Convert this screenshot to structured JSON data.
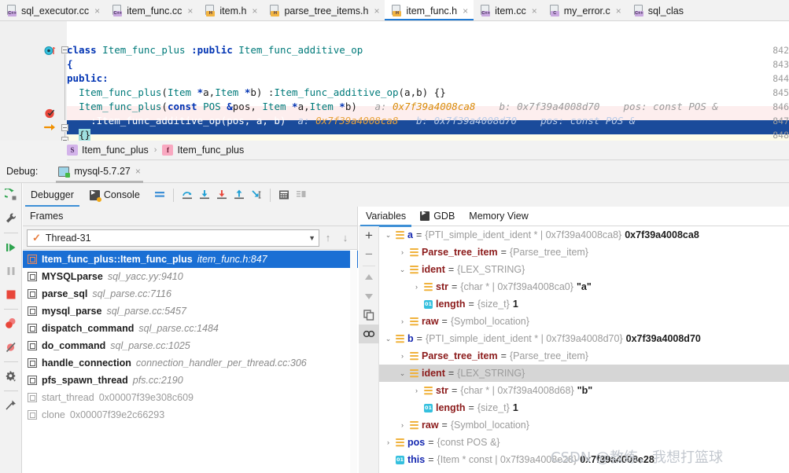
{
  "editor_tabs": [
    {
      "label": "sql_executor.cc",
      "kind": "cpp",
      "badge": "C++",
      "active": false,
      "close": "×"
    },
    {
      "label": "item_func.cc",
      "kind": "cpp",
      "badge": "C++",
      "active": false,
      "close": "×"
    },
    {
      "label": "item.h",
      "kind": "h",
      "badge": "H",
      "active": false,
      "close": "×"
    },
    {
      "label": "parse_tree_items.h",
      "kind": "h",
      "badge": "H",
      "active": false,
      "close": "×"
    },
    {
      "label": "item_func.h",
      "kind": "h",
      "badge": "H",
      "active": true,
      "close": "×"
    },
    {
      "label": "item.cc",
      "kind": "cpp",
      "badge": "C++",
      "active": false,
      "close": "×"
    },
    {
      "label": "my_error.c",
      "kind": "c",
      "badge": "C",
      "active": false,
      "close": "×"
    },
    {
      "label": "sql_clas",
      "kind": "cpp",
      "badge": "C++",
      "active": false,
      "close": ""
    }
  ],
  "code": {
    "line_numbers": [
      "842",
      "843",
      "844",
      "845",
      "846",
      "847",
      "848"
    ],
    "lines": [
      {
        "n": "842",
        "text": "class Item_func_plus :public Item_func_additive_op",
        "bg": "none"
      },
      {
        "n": "843",
        "text": "{",
        "bg": "none"
      },
      {
        "n": "844",
        "text": "public:",
        "bg": "none"
      },
      {
        "n": "845",
        "text": "  Item_func_plus(Item *a,Item *b) :Item_func_additive_op(a,b) {}",
        "bg": "none"
      },
      {
        "n": "846",
        "text": "  Item_func_plus(const POS &pos, Item *a,Item *b)",
        "bg": "exec"
      },
      {
        "n": "847",
        "text": "    :Item_func_additive_op(pos, a, b)",
        "bg": "cur"
      },
      {
        "n": "848",
        "text": "  {}",
        "bg": "last"
      }
    ],
    "inline_hints": {
      "line846": [
        {
          "label": "a:",
          "value": "0x7f39a4008ca8"
        },
        {
          "label": "b:",
          "value": "0x7f39a4008d70"
        },
        {
          "label": "pos:",
          "value": "const POS &"
        }
      ],
      "line847": [
        {
          "label": "a:",
          "value": "0x7f39a4008ca8"
        },
        {
          "label": "b:",
          "value": "0x7f39a4008d70"
        },
        {
          "label": "pos:",
          "value": "const POS &"
        }
      ]
    }
  },
  "breadcrumb": [
    {
      "chip": "S",
      "label": "Item_func_plus"
    },
    {
      "chip": "f",
      "label": "Item_func_plus"
    }
  ],
  "breadcrumb_separator": "›",
  "debug_header": {
    "label": "Debug:",
    "run_config": "mysql-5.7.27",
    "close": "×"
  },
  "debugger_tabs": [
    {
      "label": "Debugger",
      "active": true
    },
    {
      "label": "Console",
      "active": false
    }
  ],
  "frames": {
    "header": "Frames",
    "thread": "Thread-31",
    "items": [
      {
        "fn": "Item_func_plus::Item_func_plus",
        "loc": "item_func.h:847",
        "selected": true,
        "dim": false
      },
      {
        "fn": "MYSQLparse",
        "loc": "sql_yacc.yy:9410",
        "selected": false,
        "dim": false
      },
      {
        "fn": "parse_sql",
        "loc": "sql_parse.cc:7116",
        "selected": false,
        "dim": false
      },
      {
        "fn": "mysql_parse",
        "loc": "sql_parse.cc:5457",
        "selected": false,
        "dim": false
      },
      {
        "fn": "dispatch_command",
        "loc": "sql_parse.cc:1484",
        "selected": false,
        "dim": false
      },
      {
        "fn": "do_command",
        "loc": "sql_parse.cc:1025",
        "selected": false,
        "dim": false
      },
      {
        "fn": "handle_connection",
        "loc": "connection_handler_per_thread.cc:306",
        "selected": false,
        "dim": false
      },
      {
        "fn": "pfs_spawn_thread",
        "loc": "pfs.cc:2190",
        "selected": false,
        "dim": false
      },
      {
        "fn": "start_thread",
        "loc": "0x00007f39e308c609",
        "selected": false,
        "dim": true
      },
      {
        "fn": "clone",
        "loc": "0x00007f39e2c66293",
        "selected": false,
        "dim": true
      }
    ]
  },
  "variables": {
    "tabs": [
      {
        "label": "Variables",
        "active": true
      },
      {
        "label": "GDB",
        "active": false
      },
      {
        "label": "Memory View",
        "active": false
      }
    ],
    "rows": [
      {
        "indent": 0,
        "twisty": "⌄",
        "icon": "struct",
        "icon_label": "",
        "name": "a",
        "name_color": "blue",
        "type": "{PTI_simple_ident_ident * | 0x7f39a4008ca8}",
        "value": "0x7f39a4008ca8",
        "selected": false
      },
      {
        "indent": 1,
        "twisty": "›",
        "icon": "struct",
        "icon_label": "",
        "name": "Parse_tree_item",
        "name_color": "red",
        "type": "{Parse_tree_item}",
        "value": "",
        "selected": false
      },
      {
        "indent": 1,
        "twisty": "⌄",
        "icon": "struct",
        "icon_label": "",
        "name": "ident",
        "name_color": "red",
        "type": "{LEX_STRING}",
        "value": "",
        "selected": false
      },
      {
        "indent": 2,
        "twisty": "›",
        "icon": "struct",
        "icon_label": "",
        "name": "str",
        "name_color": "red",
        "type": "{char * | 0x7f39a4008ca0}",
        "value": "\"a\"",
        "selected": false
      },
      {
        "indent": 2,
        "twisty": "",
        "icon": "prim",
        "icon_label": "01",
        "name": "length",
        "name_color": "red",
        "type": "{size_t}",
        "value": "1",
        "selected": false
      },
      {
        "indent": 1,
        "twisty": "›",
        "icon": "struct",
        "icon_label": "",
        "name": "raw",
        "name_color": "red",
        "type": "{Symbol_location}",
        "value": "",
        "selected": false
      },
      {
        "indent": 0,
        "twisty": "⌄",
        "icon": "struct",
        "icon_label": "",
        "name": "b",
        "name_color": "blue",
        "type": "{PTI_simple_ident_ident * | 0x7f39a4008d70}",
        "value": "0x7f39a4008d70",
        "selected": false
      },
      {
        "indent": 1,
        "twisty": "›",
        "icon": "struct",
        "icon_label": "",
        "name": "Parse_tree_item",
        "name_color": "red",
        "type": "{Parse_tree_item}",
        "value": "",
        "selected": false
      },
      {
        "indent": 1,
        "twisty": "⌄",
        "icon": "struct",
        "icon_label": "",
        "name": "ident",
        "name_color": "red",
        "type": "{LEX_STRING}",
        "value": "",
        "selected": true
      },
      {
        "indent": 2,
        "twisty": "›",
        "icon": "struct",
        "icon_label": "",
        "name": "str",
        "name_color": "red",
        "type": "{char * | 0x7f39a4008d68}",
        "value": "\"b\"",
        "selected": false
      },
      {
        "indent": 2,
        "twisty": "",
        "icon": "prim",
        "icon_label": "01",
        "name": "length",
        "name_color": "red",
        "type": "{size_t}",
        "value": "1",
        "selected": false
      },
      {
        "indent": 1,
        "twisty": "›",
        "icon": "struct",
        "icon_label": "",
        "name": "raw",
        "name_color": "red",
        "type": "{Symbol_location}",
        "value": "",
        "selected": false
      },
      {
        "indent": 0,
        "twisty": "›",
        "icon": "struct",
        "icon_label": "",
        "name": "pos",
        "name_color": "blue",
        "type": "{const POS &}",
        "value": "",
        "selected": false
      },
      {
        "indent": 0,
        "twisty": "",
        "icon": "prim",
        "icon_label": "01",
        "name": "this",
        "name_color": "blue",
        "type": "{Item * const | 0x7f39a4008e28}",
        "value": "0x7f39a4008e28",
        "selected": false
      }
    ]
  },
  "watermark": "CSDN @教练，我想打篮球",
  "colors": {
    "accent_blue": "#1f7ad4",
    "selection_blue": "#1a6fd4",
    "exec_pink": "#fdeeee",
    "current_line_blue": "#1a4b9b",
    "keyword": "#0033b3",
    "type": "#007a7a",
    "hint_value": "#d98c0a",
    "var_name_red": "#8b1a1a",
    "var_name_blue": "#1528b0"
  }
}
